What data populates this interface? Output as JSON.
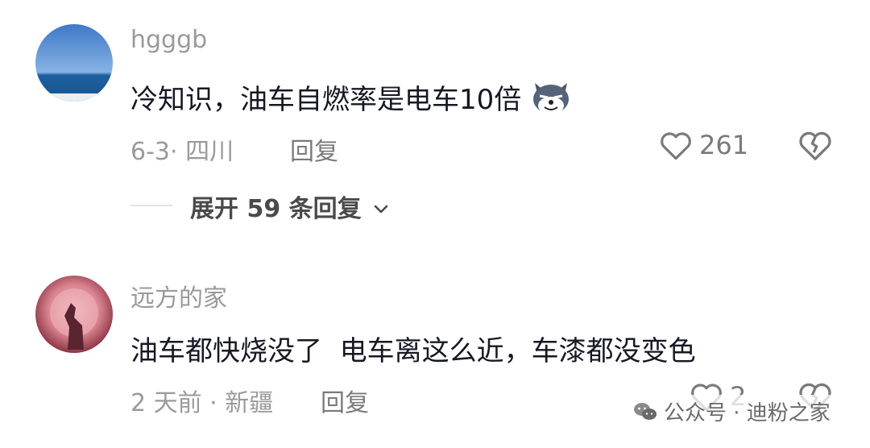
{
  "comments": [
    {
      "username": "hgggb",
      "text": "冷知识，油车自燃率是电车10倍",
      "emoji": "wolf-face-emoji",
      "meta": "6-3· 四川",
      "reply_label": "回复",
      "like_count": "261"
    },
    {
      "username": "远方的家",
      "text": "油车都快烧没了  电车离这么近，车漆都没变色",
      "meta": "2 天前 · 新疆",
      "reply_label": "回复",
      "like_count": "2"
    }
  ],
  "expand_replies": "展开 59 条回复",
  "watermark": "公众号 · 迪粉之家",
  "icons": [
    "heart-outline-icon",
    "broken-heart-icon",
    "chevron-down-icon",
    "wechat-icon"
  ],
  "colors": {
    "text": "#161823",
    "muted": "#9a9a9a",
    "background": "#ffffff"
  }
}
